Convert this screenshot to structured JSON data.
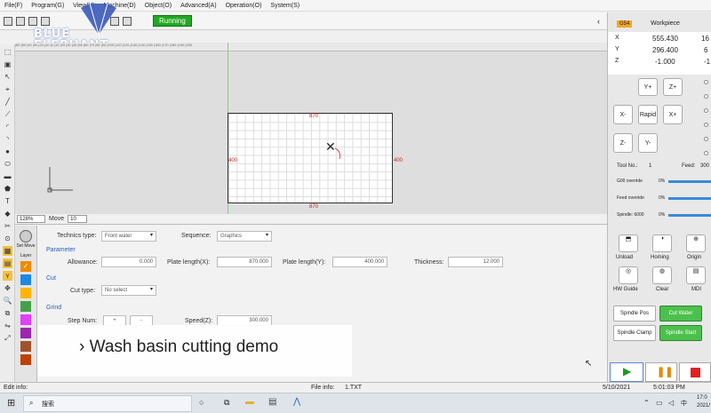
{
  "menu": [
    "File(F)",
    "Program(G)",
    "View(V)",
    "Machine(D)",
    "Object(O)",
    "Advanced(A)",
    "Operation(O)",
    "System(S)"
  ],
  "toolbar": {
    "status": "Running"
  },
  "logo": {
    "line1": "BLUE",
    "line2": "ELEPHANT"
  },
  "ruler": "|60 |50 |40 |30 |20 |10 |0 |10 |20 |30 |40 |50 |60 |70 |80 |90 |100 |110 |120 |130 |140 |150 |160 |170 |180 |190 |200",
  "workpiece": {
    "top_dim": "870",
    "bottom_dim": "870",
    "left_dim": "400",
    "right_dim": "400"
  },
  "zoom": {
    "value": "128%",
    "move_label": "Move",
    "move_value": "10"
  },
  "side": {
    "set_move": "Set Move",
    "layer": "Layer"
  },
  "params": {
    "technics_label": "Technics type:",
    "technics_value": "Front water",
    "sequence_label": "Sequence:",
    "sequence_value": "Graphics",
    "parameter_title": "Parameter",
    "allowance_label": "Allowance:",
    "allowance_value": "0.000",
    "plate_x_label": "Plate length(X):",
    "plate_x_value": "870.000",
    "plate_y_label": "Plate length(Y):",
    "plate_y_value": "400.000",
    "thickness_label": "Thickness:",
    "thickness_value": "12.000",
    "cut_title": "Cut",
    "cut_type_label": "Cut type:",
    "cut_type_value": "No select",
    "grind_title": "Grind",
    "step_num_label": "Step Num:",
    "step_plus": "+",
    "step_minus": "-",
    "speed_label": "Speed(Z):",
    "speed_value": "300.000"
  },
  "caption": "› Wash basin cutting demo",
  "right": {
    "coord_sys": "G54",
    "workpiece_label": "Workpiece",
    "coords": [
      {
        "axis": "X",
        "value": "555.430",
        "extra": "16"
      },
      {
        "axis": "Y",
        "value": "296.400",
        "extra": "6"
      },
      {
        "axis": "Z",
        "value": "-1.000",
        "extra": "-1"
      }
    ],
    "jog": {
      "y_plus": "Y+",
      "z_plus": "Z+",
      "x_minus": "X-",
      "rapid": "Rapid",
      "x_plus": "X+",
      "z_minus": "Z-",
      "y_minus": "Y-"
    },
    "tool_no_label": "Tool No.:",
    "tool_no_value": "1",
    "feed_label": "Feed:",
    "feed_value": "300",
    "overrides": [
      {
        "label": "G00 override",
        "pct": "0%"
      },
      {
        "label": "Feed override",
        "pct": "0%"
      },
      {
        "label": "Spindle: 6000",
        "pct": "0%"
      }
    ],
    "buttons": [
      "Unload",
      "Homing",
      "Origin",
      "HW Guide",
      "Clear",
      "MDI"
    ],
    "io": [
      "Spindle Pos",
      "Cut Water",
      "Spindle Clamp",
      "Spindle Start"
    ]
  },
  "statusbar": {
    "edit_info": "Edit info:",
    "file_info_label": "File info:",
    "file_name": "1.TXT",
    "date": "5/10/2021",
    "time": "5:01:03 PM"
  },
  "taskbar": {
    "search": "搜索",
    "clock": "17:0",
    "date": "2021/"
  }
}
